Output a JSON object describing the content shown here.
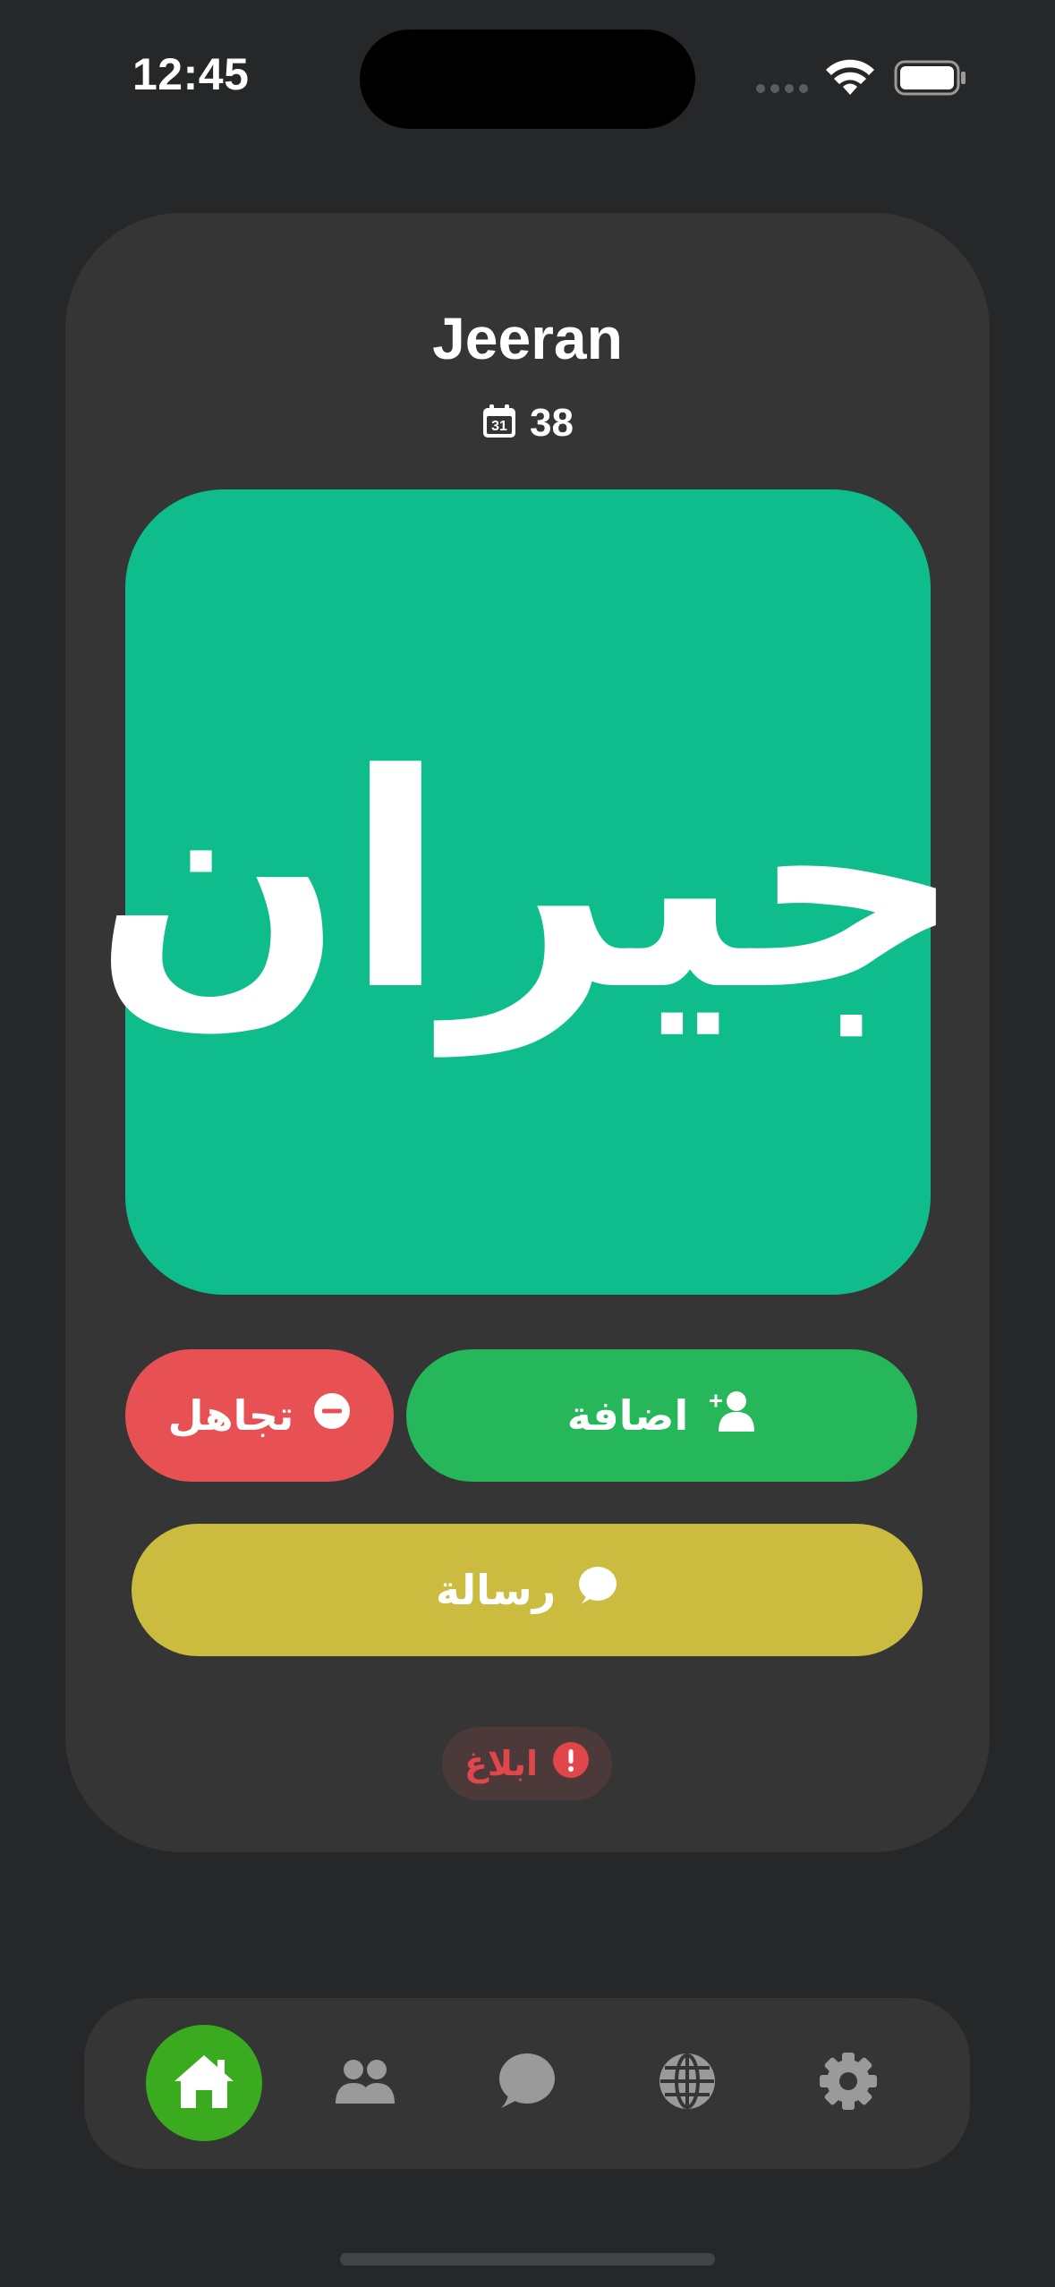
{
  "status_bar": {
    "time": "12:45"
  },
  "profile": {
    "name": "Jeeran",
    "age": "38",
    "age_icon": "calendar-icon",
    "logo_text": "جيران"
  },
  "actions": {
    "add_label": "اضافة",
    "add_icon": "add-user-icon",
    "ignore_label": "تجاهل",
    "ignore_icon": "minus-circle-icon",
    "message_label": "رسالة",
    "message_icon": "chat-bubble-icon",
    "report_label": "ابلاغ",
    "report_icon": "exclamation-circle-icon"
  },
  "tabbar": {
    "items": [
      {
        "icon": "home-icon",
        "active": true
      },
      {
        "icon": "users-icon",
        "active": false
      },
      {
        "icon": "chat-icon",
        "active": false
      },
      {
        "icon": "globe-icon",
        "active": false
      },
      {
        "icon": "gear-icon",
        "active": false
      }
    ]
  },
  "colors": {
    "background": "#262728",
    "card": "#353536",
    "logo_tile": "#0fbd8c",
    "add": "#25b75a",
    "ignore": "#e75154",
    "message": "#cbbb3f",
    "report_text": "#e0464a",
    "tab_active": "#3aaa1e"
  }
}
